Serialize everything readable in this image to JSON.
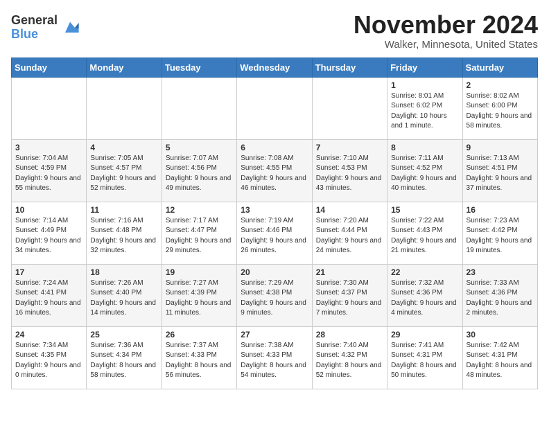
{
  "header": {
    "logo_general": "General",
    "logo_blue": "Blue",
    "title": "November 2024",
    "location": "Walker, Minnesota, United States"
  },
  "days_of_week": [
    "Sunday",
    "Monday",
    "Tuesday",
    "Wednesday",
    "Thursday",
    "Friday",
    "Saturday"
  ],
  "weeks": [
    [
      {
        "day": "",
        "info": ""
      },
      {
        "day": "",
        "info": ""
      },
      {
        "day": "",
        "info": ""
      },
      {
        "day": "",
        "info": ""
      },
      {
        "day": "",
        "info": ""
      },
      {
        "day": "1",
        "info": "Sunrise: 8:01 AM\nSunset: 6:02 PM\nDaylight: 10 hours and 1 minute."
      },
      {
        "day": "2",
        "info": "Sunrise: 8:02 AM\nSunset: 6:00 PM\nDaylight: 9 hours and 58 minutes."
      }
    ],
    [
      {
        "day": "3",
        "info": "Sunrise: 7:04 AM\nSunset: 4:59 PM\nDaylight: 9 hours and 55 minutes."
      },
      {
        "day": "4",
        "info": "Sunrise: 7:05 AM\nSunset: 4:57 PM\nDaylight: 9 hours and 52 minutes."
      },
      {
        "day": "5",
        "info": "Sunrise: 7:07 AM\nSunset: 4:56 PM\nDaylight: 9 hours and 49 minutes."
      },
      {
        "day": "6",
        "info": "Sunrise: 7:08 AM\nSunset: 4:55 PM\nDaylight: 9 hours and 46 minutes."
      },
      {
        "day": "7",
        "info": "Sunrise: 7:10 AM\nSunset: 4:53 PM\nDaylight: 9 hours and 43 minutes."
      },
      {
        "day": "8",
        "info": "Sunrise: 7:11 AM\nSunset: 4:52 PM\nDaylight: 9 hours and 40 minutes."
      },
      {
        "day": "9",
        "info": "Sunrise: 7:13 AM\nSunset: 4:51 PM\nDaylight: 9 hours and 37 minutes."
      }
    ],
    [
      {
        "day": "10",
        "info": "Sunrise: 7:14 AM\nSunset: 4:49 PM\nDaylight: 9 hours and 34 minutes."
      },
      {
        "day": "11",
        "info": "Sunrise: 7:16 AM\nSunset: 4:48 PM\nDaylight: 9 hours and 32 minutes."
      },
      {
        "day": "12",
        "info": "Sunrise: 7:17 AM\nSunset: 4:47 PM\nDaylight: 9 hours and 29 minutes."
      },
      {
        "day": "13",
        "info": "Sunrise: 7:19 AM\nSunset: 4:46 PM\nDaylight: 9 hours and 26 minutes."
      },
      {
        "day": "14",
        "info": "Sunrise: 7:20 AM\nSunset: 4:44 PM\nDaylight: 9 hours and 24 minutes."
      },
      {
        "day": "15",
        "info": "Sunrise: 7:22 AM\nSunset: 4:43 PM\nDaylight: 9 hours and 21 minutes."
      },
      {
        "day": "16",
        "info": "Sunrise: 7:23 AM\nSunset: 4:42 PM\nDaylight: 9 hours and 19 minutes."
      }
    ],
    [
      {
        "day": "17",
        "info": "Sunrise: 7:24 AM\nSunset: 4:41 PM\nDaylight: 9 hours and 16 minutes."
      },
      {
        "day": "18",
        "info": "Sunrise: 7:26 AM\nSunset: 4:40 PM\nDaylight: 9 hours and 14 minutes."
      },
      {
        "day": "19",
        "info": "Sunrise: 7:27 AM\nSunset: 4:39 PM\nDaylight: 9 hours and 11 minutes."
      },
      {
        "day": "20",
        "info": "Sunrise: 7:29 AM\nSunset: 4:38 PM\nDaylight: 9 hours and 9 minutes."
      },
      {
        "day": "21",
        "info": "Sunrise: 7:30 AM\nSunset: 4:37 PM\nDaylight: 9 hours and 7 minutes."
      },
      {
        "day": "22",
        "info": "Sunrise: 7:32 AM\nSunset: 4:36 PM\nDaylight: 9 hours and 4 minutes."
      },
      {
        "day": "23",
        "info": "Sunrise: 7:33 AM\nSunset: 4:36 PM\nDaylight: 9 hours and 2 minutes."
      }
    ],
    [
      {
        "day": "24",
        "info": "Sunrise: 7:34 AM\nSunset: 4:35 PM\nDaylight: 9 hours and 0 minutes."
      },
      {
        "day": "25",
        "info": "Sunrise: 7:36 AM\nSunset: 4:34 PM\nDaylight: 8 hours and 58 minutes."
      },
      {
        "day": "26",
        "info": "Sunrise: 7:37 AM\nSunset: 4:33 PM\nDaylight: 8 hours and 56 minutes."
      },
      {
        "day": "27",
        "info": "Sunrise: 7:38 AM\nSunset: 4:33 PM\nDaylight: 8 hours and 54 minutes."
      },
      {
        "day": "28",
        "info": "Sunrise: 7:40 AM\nSunset: 4:32 PM\nDaylight: 8 hours and 52 minutes."
      },
      {
        "day": "29",
        "info": "Sunrise: 7:41 AM\nSunset: 4:31 PM\nDaylight: 8 hours and 50 minutes."
      },
      {
        "day": "30",
        "info": "Sunrise: 7:42 AM\nSunset: 4:31 PM\nDaylight: 8 hours and 48 minutes."
      }
    ]
  ]
}
